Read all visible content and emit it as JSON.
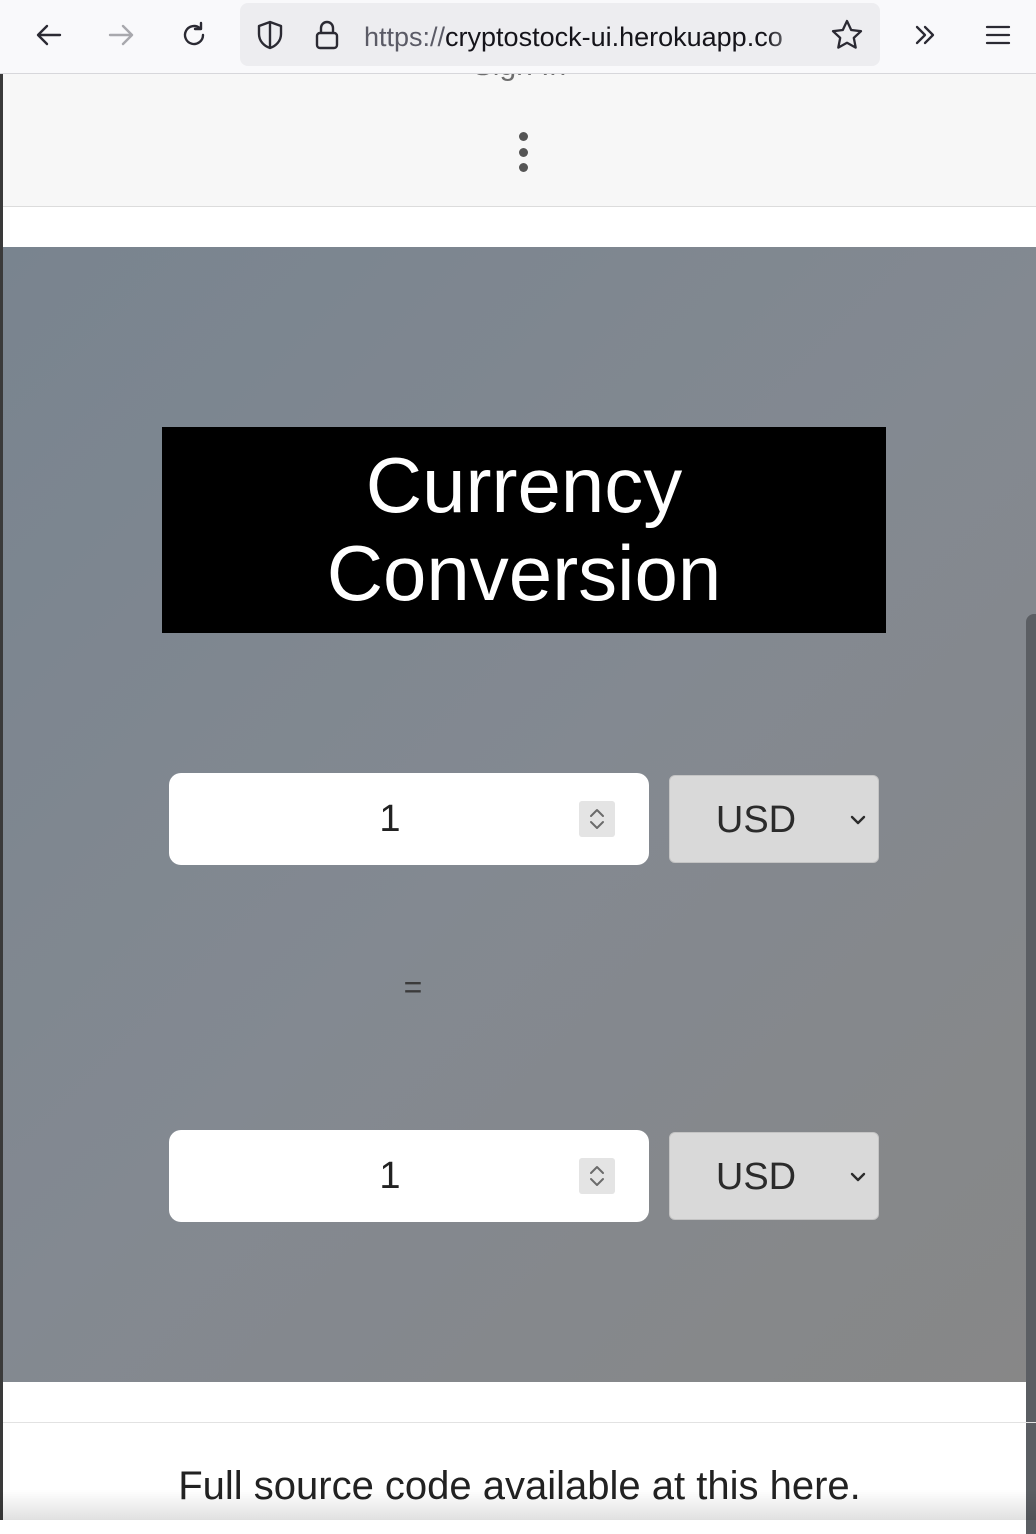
{
  "browser": {
    "url_scheme": "https://",
    "url_host": "cryptostock-ui.herokuapp.co"
  },
  "header": {
    "sign_in_label": "Sign In"
  },
  "converter": {
    "title_line1": "Currency",
    "title_line2": "Conversion",
    "from_amount": "1",
    "from_currency": "USD",
    "equals": "=",
    "to_amount": "1",
    "to_currency": "USD"
  },
  "footer": {
    "text": "Full source code available at this here."
  },
  "colors": {
    "title_bg": "#000000",
    "hero_gradient_start": "#79848f",
    "hero_gradient_end": "#878787"
  }
}
